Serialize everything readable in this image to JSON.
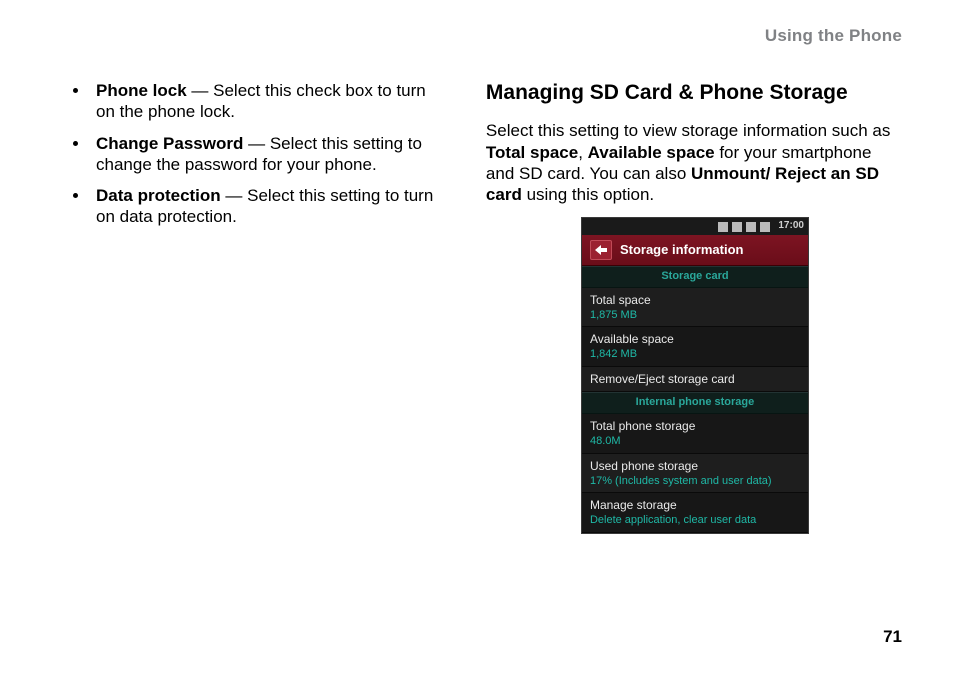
{
  "header": {
    "section_label": "Using the Phone"
  },
  "page_number": "71",
  "left_column": {
    "bullets": [
      {
        "term": "Phone lock",
        "desc": " — Select this check box to turn on the phone lock."
      },
      {
        "term": "Change Password",
        "desc": " — Select this setting to change the password for your phone."
      },
      {
        "term": "Data protection",
        "desc": " — Select this setting to turn on data protection."
      }
    ]
  },
  "right_column": {
    "heading": "Managing SD Card & Phone Storage",
    "para_parts": {
      "p1": "Select this setting to view storage information such as ",
      "b1": "Total space",
      "sep1": ", ",
      "b2": "Available space",
      "p2": " for your smartphone and SD card. You can also ",
      "b3": "Unmount/ Reject an SD card",
      "p3": " using this option."
    }
  },
  "phone": {
    "status": {
      "time": "17:00"
    },
    "title": "Storage information",
    "section1_label": "Storage card",
    "row1": {
      "label": "Total space",
      "value": "1,875 MB"
    },
    "row2": {
      "label": "Available space",
      "value": "1,842 MB"
    },
    "row3": {
      "label": "Remove/Eject storage card"
    },
    "section2_label": "Internal phone storage",
    "row4": {
      "label": "Total phone storage",
      "value": "48.0M"
    },
    "row5": {
      "label": "Used phone storage",
      "value": "17% (Includes system and user data)"
    },
    "row6": {
      "label": "Manage storage",
      "value": "Delete application, clear user data"
    }
  }
}
